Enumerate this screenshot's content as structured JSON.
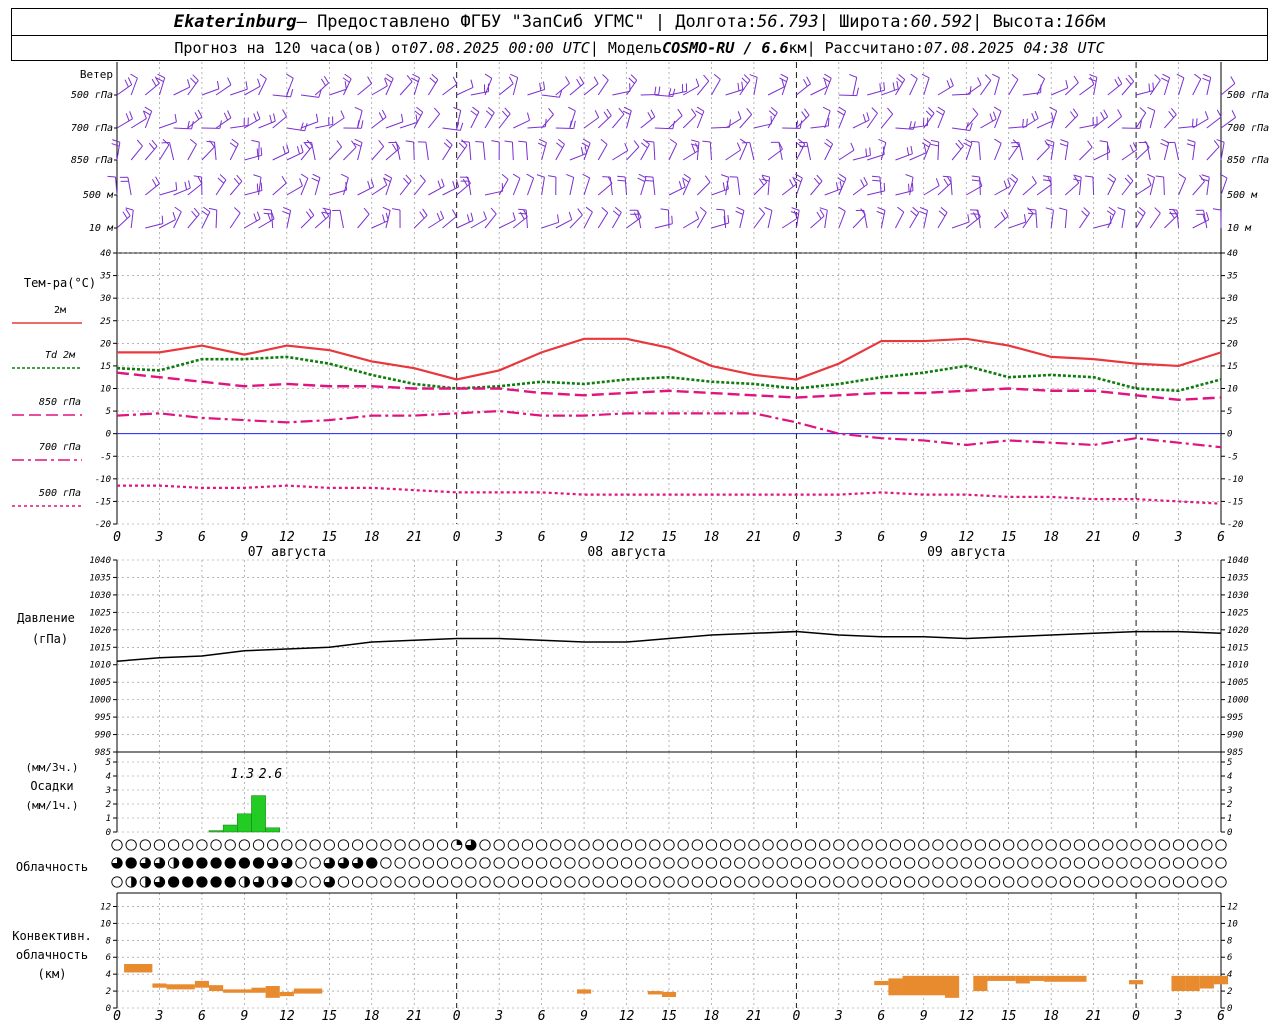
{
  "header": {
    "city": "Ekaterinburg",
    "provider": " – Предоставлено ФГБУ \"ЗапСиб УГМС\" | Долгота: ",
    "lon": "56.793",
    "lat_label": " | Широта: ",
    "lat": "60.592",
    "alt_label": " | Высота: ",
    "alt": "166",
    "alt_unit": "м",
    "fc_label": "Прогноз на 120 часа(ов) от ",
    "fc_date": "07.08.2025 00:00 UTC",
    "model_label": "  | Модель ",
    "model": "COSMO-RU / 6.6",
    "model_unit": "км",
    "calc_label": " | Рассчитано: ",
    "calc_date": "07.08.2025 04:38 UTC"
  },
  "x_axis": {
    "ticks": [
      "0",
      "3",
      "6",
      "9",
      "12",
      "15",
      "18",
      "21",
      "0",
      "3",
      "6",
      "9",
      "12",
      "15",
      "18",
      "21",
      "0",
      "3",
      "6",
      "9",
      "12",
      "15",
      "18",
      "21",
      "0",
      "3",
      "6"
    ],
    "days": [
      "07 августа",
      "08 августа",
      "09 августа"
    ]
  },
  "wind_panel": {
    "title": "Ветер",
    "levels": [
      "500 гПа",
      "700 гПа",
      "850 гПа",
      "500 м",
      "10 м"
    ]
  },
  "temp_panel": {
    "title": "Тем-ра(°C)",
    "y_ticks": [
      "40",
      "35",
      "30",
      "25",
      "20",
      "15",
      "10",
      "5",
      "0",
      "-5",
      "-10",
      "-15",
      "-20"
    ],
    "legend": [
      {
        "label": "2м",
        "color": "#e8383d"
      },
      {
        "label": "Td  2м",
        "color": "#0d7d0d"
      },
      {
        "label": "850 гПа",
        "color": "#e0147f"
      },
      {
        "label": "700 гПа",
        "color": "#e0147f"
      },
      {
        "label": "500 гПа",
        "color": "#e0147f"
      }
    ]
  },
  "pressure_panel": {
    "title1": "Давление",
    "title2": "(гПа)",
    "y_ticks": [
      "1040",
      "1035",
      "1030",
      "1025",
      "1020",
      "1015",
      "1010",
      "1005",
      "1000",
      "995",
      "990",
      "985"
    ]
  },
  "precip_panel": {
    "title1": "(мм/3ч.)",
    "title2": "Осадки",
    "title3": "(мм/1ч.)",
    "y_ticks": [
      "5",
      "4",
      "3",
      "2",
      "1",
      "0"
    ],
    "labels": [
      "1.3",
      "2.6"
    ]
  },
  "cloud_panel": {
    "title": "Облачность"
  },
  "conv_panel": {
    "title1": "Конвективн.",
    "title2": "облачность",
    "title3": "(км)",
    "y_ticks": [
      "12",
      "10",
      "8",
      "6",
      "4",
      "2",
      "0"
    ]
  },
  "colors": {
    "wind": "#7a2fcf",
    "t2m": "#e8383d",
    "td": "#0d7d0d",
    "upper": "#e0147f",
    "precip": "#22cc22",
    "conv": "#e88a2e",
    "zero_line": "#2020ff"
  },
  "chart_data": [
    {
      "type": "line",
      "title": "Тем-ра(°C)",
      "x": [
        0,
        3,
        6,
        9,
        12,
        15,
        18,
        21,
        24,
        27,
        30,
        33,
        36,
        39,
        42,
        45,
        48,
        51,
        54,
        57,
        60,
        63,
        66,
        69,
        72,
        75,
        78
      ],
      "ylim": [
        -20,
        40
      ],
      "series": [
        {
          "name": "2м",
          "values": [
            18,
            18,
            19.5,
            17.5,
            19.5,
            18.5,
            16,
            14.5,
            12,
            14,
            18,
            21,
            21,
            19,
            15,
            13,
            12,
            15.5,
            20.5,
            20.5,
            21,
            19.5,
            17,
            16.5,
            15.5,
            15,
            18
          ]
        },
        {
          "name": "Td  2м",
          "values": [
            14.5,
            14,
            16.5,
            16.5,
            17,
            15.5,
            13,
            11,
            10,
            10.5,
            11.5,
            11,
            12,
            12.5,
            11.5,
            11,
            10,
            11,
            12.5,
            13.5,
            15,
            12.5,
            13,
            12.5,
            10,
            9.5,
            12
          ]
        },
        {
          "name": "850 гПа",
          "values": [
            13.5,
            12.5,
            11.5,
            10.5,
            11,
            10.5,
            10.5,
            10,
            10,
            10,
            9,
            8.5,
            9,
            9.5,
            9,
            8.5,
            8,
            8.5,
            9,
            9,
            9.5,
            10,
            9.5,
            9.5,
            8.5,
            7.5,
            8
          ]
        },
        {
          "name": "700 гПа",
          "values": [
            4,
            4.5,
            3.5,
            3,
            2.5,
            3,
            4,
            4,
            4.5,
            5,
            4,
            4,
            4.5,
            4.5,
            4.5,
            4.5,
            2.5,
            0,
            -1,
            -1.5,
            -2.5,
            -1.5,
            -2,
            -2.5,
            -1,
            -2,
            -3
          ]
        },
        {
          "name": "500 гПа",
          "values": [
            -11.5,
            -11.5,
            -12,
            -12,
            -11.5,
            -12,
            -12,
            -12.5,
            -13,
            -13,
            -13,
            -13.5,
            -13.5,
            -13.5,
            -13.5,
            -13.5,
            -13.5,
            -13.5,
            -13,
            -13.5,
            -13.5,
            -14,
            -14,
            -14.5,
            -14.5,
            -15,
            -15.5
          ]
        }
      ]
    },
    {
      "type": "line",
      "title": "Давление",
      "x": [
        0,
        3,
        6,
        9,
        12,
        15,
        18,
        21,
        24,
        27,
        30,
        33,
        36,
        39,
        42,
        45,
        48,
        51,
        54,
        57,
        60,
        63,
        66,
        69,
        72,
        75,
        78
      ],
      "ylim": [
        985,
        1040
      ],
      "series": [
        {
          "name": "Давление",
          "values": [
            1011,
            1012,
            1012.5,
            1014,
            1014.5,
            1015,
            1016.5,
            1017,
            1017.5,
            1017.5,
            1017,
            1016.5,
            1016.5,
            1017.5,
            1018.5,
            1019,
            1019.5,
            1018.5,
            1018,
            1018,
            1017.5,
            1018,
            1018.5,
            1019,
            1019.5,
            1019.5,
            1019
          ]
        }
      ]
    },
    {
      "type": "bar",
      "title": "Осадки",
      "x": [
        7,
        8,
        9,
        10,
        11
      ],
      "ylim": [
        0,
        5
      ],
      "series": [
        {
          "name": "мм/1ч.",
          "values": [
            0.1,
            0.5,
            1.3,
            2.6,
            0.3
          ]
        }
      ]
    },
    {
      "type": "bar",
      "title": "Конвективн. облачность",
      "ylim": [
        0,
        13
      ],
      "segments": [
        {
          "x0": 0.5,
          "x1": 2.5,
          "bottom": 4.2,
          "top": 5.2
        },
        {
          "x0": 2.5,
          "x1": 3.5,
          "bottom": 2.4,
          "top": 2.9
        },
        {
          "x0": 3.5,
          "x1": 5.5,
          "bottom": 2.2,
          "top": 2.8
        },
        {
          "x0": 5.5,
          "x1": 6.5,
          "bottom": 2.4,
          "top": 3.2
        },
        {
          "x0": 6.5,
          "x1": 7.5,
          "bottom": 2.0,
          "top": 2.7
        },
        {
          "x0": 7.5,
          "x1": 9.5,
          "bottom": 1.8,
          "top": 2.2
        },
        {
          "x0": 9.5,
          "x1": 10.5,
          "bottom": 1.8,
          "top": 2.4
        },
        {
          "x0": 10.5,
          "x1": 11.5,
          "bottom": 1.2,
          "top": 2.6
        },
        {
          "x0": 11.5,
          "x1": 12.5,
          "bottom": 1.4,
          "top": 1.9
        },
        {
          "x0": 12.5,
          "x1": 14.5,
          "bottom": 1.7,
          "top": 2.3
        },
        {
          "x0": 32.5,
          "x1": 33.5,
          "bottom": 1.7,
          "top": 2.2
        },
        {
          "x0": 37.5,
          "x1": 38.5,
          "bottom": 1.6,
          "top": 2.0
        },
        {
          "x0": 38.5,
          "x1": 39.5,
          "bottom": 1.3,
          "top": 1.9
        },
        {
          "x0": 53.5,
          "x1": 54.5,
          "bottom": 2.7,
          "top": 3.2
        },
        {
          "x0": 54.5,
          "x1": 55.5,
          "bottom": 1.5,
          "top": 3.5
        },
        {
          "x0": 55.5,
          "x1": 58.5,
          "bottom": 1.5,
          "top": 3.8
        },
        {
          "x0": 58.5,
          "x1": 59.5,
          "bottom": 1.2,
          "top": 3.8
        },
        {
          "x0": 60.5,
          "x1": 61.5,
          "bottom": 2.0,
          "top": 3.8
        },
        {
          "x0": 61.5,
          "x1": 63.5,
          "bottom": 3.2,
          "top": 3.8
        },
        {
          "x0": 63.5,
          "x1": 64.5,
          "bottom": 2.9,
          "top": 3.8
        },
        {
          "x0": 64.5,
          "x1": 65.5,
          "bottom": 3.2,
          "top": 3.8
        },
        {
          "x0": 65.5,
          "x1": 68.5,
          "bottom": 3.1,
          "top": 3.8
        },
        {
          "x0": 71.5,
          "x1": 72.5,
          "bottom": 2.8,
          "top": 3.3
        },
        {
          "x0": 74.5,
          "x1": 75.5,
          "bottom": 2.0,
          "top": 3.8
        },
        {
          "x0": 75.5,
          "x1": 76.5,
          "bottom": 2.0,
          "top": 3.8
        },
        {
          "x0": 76.5,
          "x1": 77.5,
          "bottom": 2.3,
          "top": 3.8
        },
        {
          "x0": 77.5,
          "x1": 78.5,
          "bottom": 2.8,
          "top": 3.8
        }
      ]
    }
  ],
  "cloud_rows": [
    "000000000000000000000000130000000000000000000000000000000000000000000000000000000000000000000000000000000000000000000000000000000000000000000000000000000000000000000000000000000000000000000000000000000000000000000000000000000000000000000000000000000000000000000000000000000000000000000000000000000000000000000000",
    "3433244444433003334000000000000000000000000000000000000000000000000000000000000000000000000000000000000000000000000000000000000000000000000000000000000000000000000000000000000000000000000000000000000000000000000000000000000000000000000000000000000000000000000000000000000000000000000000000000000000000000000",
    "0223444442323003000000000000000000000000000000000000000000000000000000000000000000000000000000000000000000000000000000000000000000000000000000000000000000000000000000000000000000000000000000000000000000000000000000000000000000000000000000000000000000000000000000000000000000000000000000000000000000000000000000"
  ]
}
